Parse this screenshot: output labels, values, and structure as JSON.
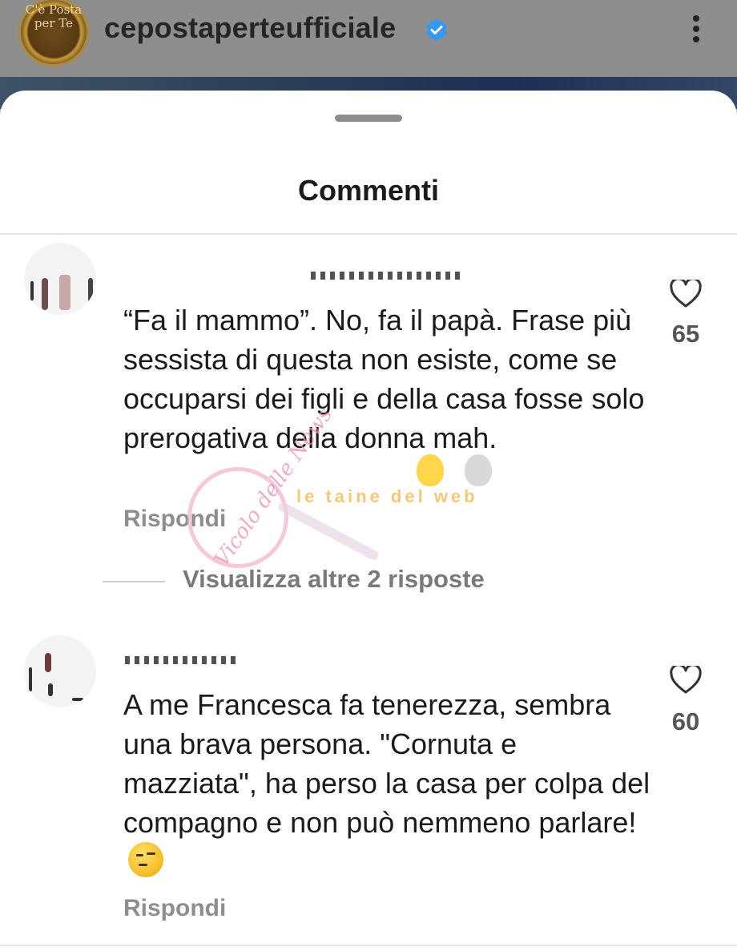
{
  "profile": {
    "logo_text": "C'è Posta per Te",
    "username": "cepostaperteufficiale",
    "verified": true
  },
  "sheet": {
    "title": "Commenti"
  },
  "comments": [
    {
      "text": "“Fa il mammo”. No, fa il papà. Frase più sessista di questa non esiste, come se occuparsi dei figli e della casa fosse solo prerogativa della donna mah.",
      "likes": "65",
      "reply_label": "Rispondi",
      "view_replies_label": "Visualizza altre 2 risposte"
    },
    {
      "text": "A me Francesca fa tenerezza, sembra una brava persona. \"Cornuta e mazziata\", ha perso la casa per colpa del compagno e non può nemmeno parlare!",
      "likes": "60",
      "reply_label": "Rispondi"
    }
  ],
  "watermark": {
    "brand_text": "Vicolo delle News",
    "tagline": "le taine del web"
  },
  "colors": {
    "verified_blue": "#3897f0",
    "secondary_text": "#8e8e8e"
  },
  "icons": [
    "verified-badge-icon",
    "more-options-icon",
    "heart-icon"
  ]
}
